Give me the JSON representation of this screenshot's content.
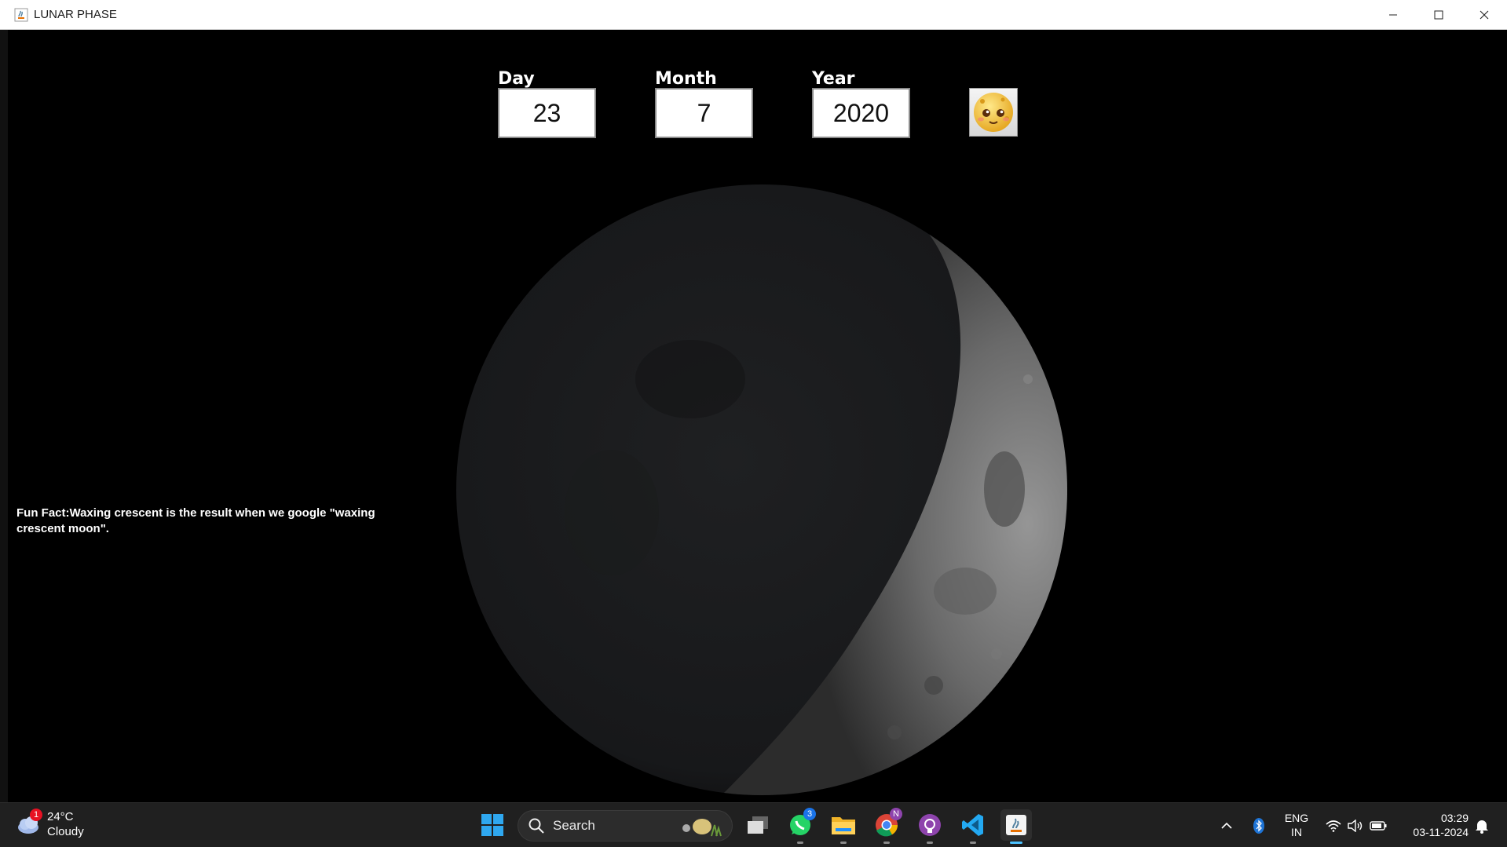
{
  "window": {
    "title": "LUNAR PHASE"
  },
  "inputs": {
    "day": {
      "label": "Day",
      "value": "23"
    },
    "month": {
      "label": "Month",
      "value": "7"
    },
    "year": {
      "label": "Year",
      "value": "2020"
    }
  },
  "fun_fact": "Fun Fact:Waxing crescent is the result when we google \"waxing crescent moon\".",
  "moon": {
    "phase_icon": "waxing-crescent-moon-image"
  },
  "taskbar": {
    "weather": {
      "temp": "24°C",
      "condition": "Cloudy",
      "badge": "1"
    },
    "search_label": "Search",
    "whatsapp_badge": "3",
    "chrome_badge": "N",
    "lang_top": "ENG",
    "lang_bottom": "IN",
    "time": "03:29",
    "date": "03-11-2024"
  },
  "colors": {
    "accent": "#4cc2ff",
    "background": "#000000"
  }
}
